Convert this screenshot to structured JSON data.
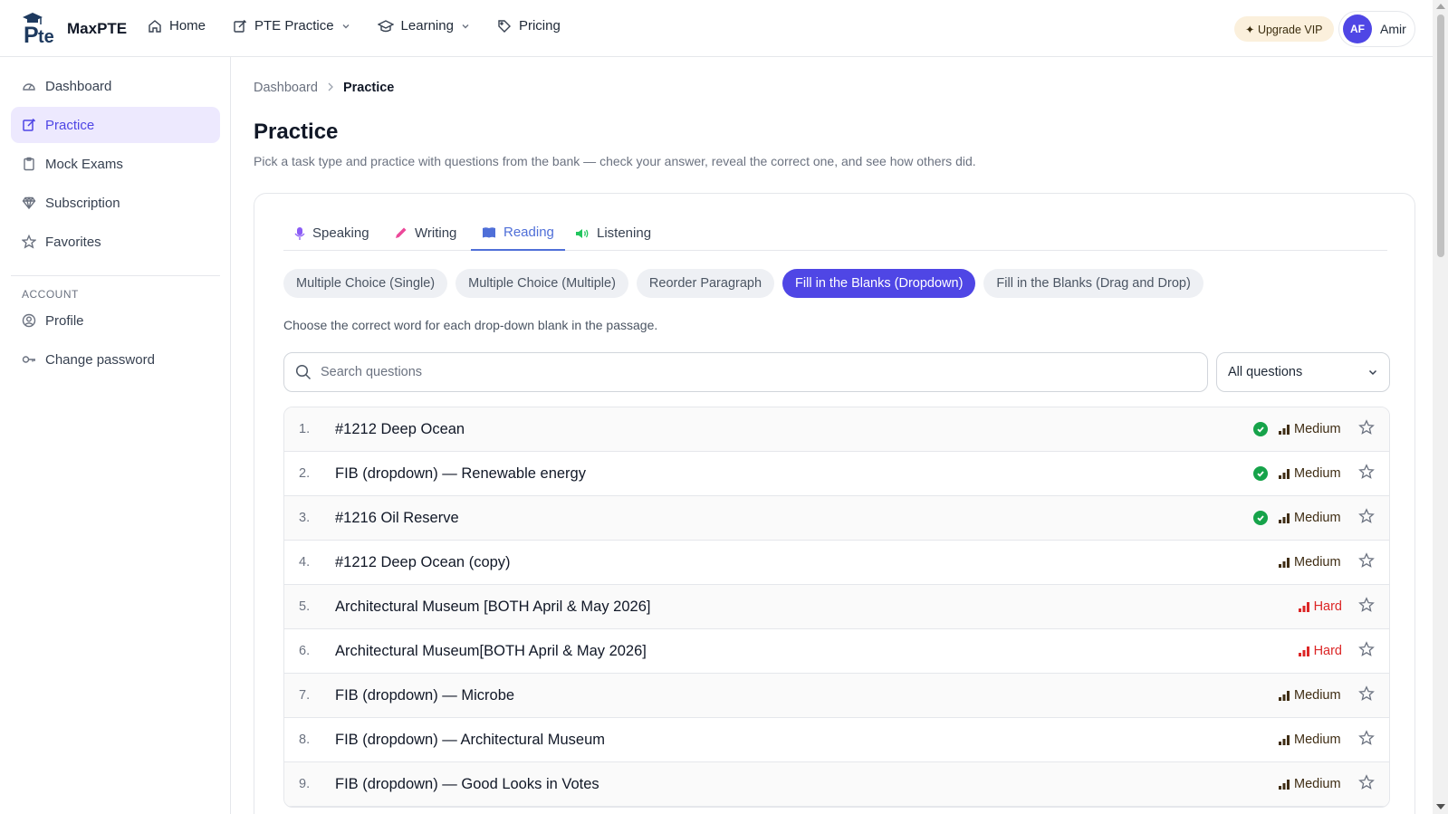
{
  "app": {
    "logo_text": "MaxPTE",
    "logo_mark": "Pte"
  },
  "nav": [
    {
      "label": "Home",
      "icon": "home-icon"
    },
    {
      "label": "PTE Practice",
      "icon": "edit-icon",
      "dropdown": true
    },
    {
      "label": "Learning",
      "icon": "graduation-cap-icon",
      "dropdown": true
    },
    {
      "label": "Pricing",
      "icon": "tag-icon"
    }
  ],
  "header": {
    "upgrade_label": "✦ Upgrade VIP",
    "avatar_initials": "AF",
    "user_name": "Amir"
  },
  "sidebar": {
    "items": [
      {
        "label": "Dashboard",
        "icon": "dashboard-icon"
      },
      {
        "label": "Practice",
        "icon": "edit-icon",
        "active": true
      },
      {
        "label": "Mock Exams",
        "icon": "clipboard-icon"
      },
      {
        "label": "Subscription",
        "icon": "diamond-icon"
      },
      {
        "label": "Favorites",
        "icon": "star-icon"
      }
    ],
    "section_label": "ACCOUNT",
    "account_items": [
      {
        "label": "Profile",
        "icon": "user-circle-icon"
      },
      {
        "label": "Change password",
        "icon": "key-icon"
      }
    ]
  },
  "breadcrumb": {
    "parent": "Dashboard",
    "current": "Practice"
  },
  "page": {
    "title": "Practice",
    "description": "Pick a task type and practice with questions from the bank — check your answer, reveal the correct one, and see how others did."
  },
  "tabs": [
    {
      "label": "Speaking",
      "icon": "microphone-icon",
      "color": "#8b5cf6"
    },
    {
      "label": "Writing",
      "icon": "pencil-icon",
      "color": "#ec4899"
    },
    {
      "label": "Reading",
      "icon": "book-icon",
      "color": "#4f6fd8",
      "active": true
    },
    {
      "label": "Listening",
      "icon": "speaker-icon",
      "color": "#22c55e"
    }
  ],
  "chips": [
    {
      "label": "Multiple Choice (Single)"
    },
    {
      "label": "Multiple Choice (Multiple)"
    },
    {
      "label": "Reorder Paragraph"
    },
    {
      "label": "Fill in the Blanks (Dropdown)",
      "active": true
    },
    {
      "label": "Fill in the Blanks (Drag and Drop)"
    }
  ],
  "hint": "Choose the correct word for each drop-down blank in the passage.",
  "search": {
    "placeholder": "Search questions",
    "value": ""
  },
  "filter": {
    "selected": "All questions"
  },
  "questions": [
    {
      "num": "1.",
      "title": "#1212 Deep Ocean",
      "done": true,
      "difficulty": "Medium"
    },
    {
      "num": "2.",
      "title": "FIB (dropdown) — Renewable energy",
      "done": true,
      "difficulty": "Medium"
    },
    {
      "num": "3.",
      "title": "#1216 Oil Reserve",
      "done": true,
      "difficulty": "Medium"
    },
    {
      "num": "4.",
      "title": "#1212 Deep Ocean (copy)",
      "done": false,
      "difficulty": "Medium"
    },
    {
      "num": "5.",
      "title": "Architectural Museum [BOTH April & May 2026]",
      "done": false,
      "difficulty": "Hard"
    },
    {
      "num": "6.",
      "title": "Architectural Museum[BOTH April & May 2026]",
      "done": false,
      "difficulty": "Hard"
    },
    {
      "num": "7.",
      "title": "FIB (dropdown) — Microbe",
      "done": false,
      "difficulty": "Medium"
    },
    {
      "num": "8.",
      "title": "FIB (dropdown) — Architectural Museum",
      "done": false,
      "difficulty": "Medium"
    },
    {
      "num": "9.",
      "title": "FIB (dropdown) — Good Looks in Votes",
      "done": false,
      "difficulty": "Medium"
    }
  ],
  "colors": {
    "accent": "#4f46e5",
    "tab_active": "#4f6fd8",
    "done": "#16a34a",
    "hard": "#dc2626",
    "medium": "#3f2d14"
  }
}
